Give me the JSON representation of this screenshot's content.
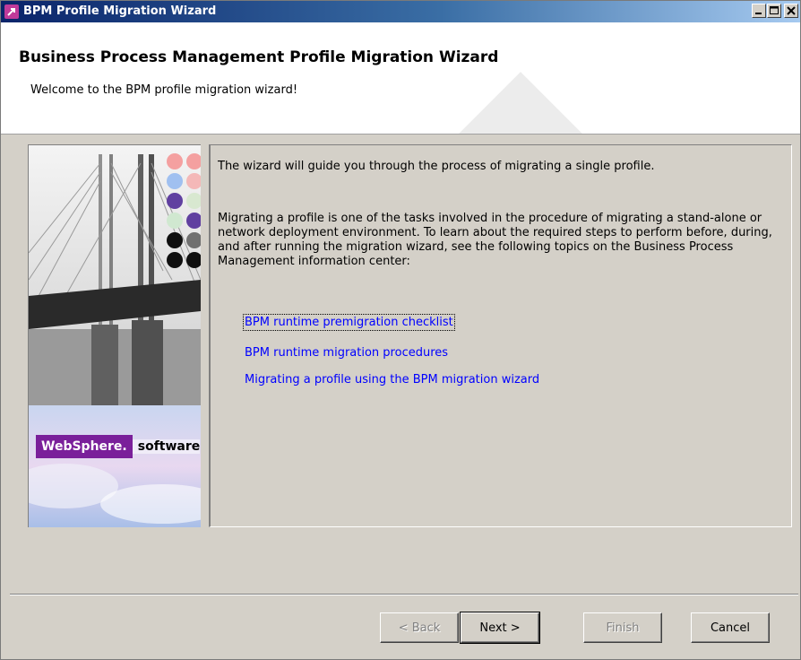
{
  "window": {
    "title": "BPM Profile Migration Wizard"
  },
  "header": {
    "title": "Business Process Management Profile Migration Wizard",
    "subtitle": "Welcome to the BPM profile migration wizard!"
  },
  "branding": {
    "logo_box": "WebSphere.",
    "logo_text": "software"
  },
  "content": {
    "intro": "The wizard will guide you through the process of migrating a single profile.",
    "details": "Migrating a profile is one of the tasks involved in the procedure of migrating a stand-alone or network deployment environment. To learn about the required steps to perform before, during, and after running the migration wizard, see the following topics on the Business Process Management information center:",
    "links": [
      "BPM runtime premigration checklist",
      "BPM runtime migration procedures",
      "Migrating a profile using the BPM migration wizard"
    ]
  },
  "buttons": {
    "back": "< Back",
    "next": "Next >",
    "finish": "Finish",
    "cancel": "Cancel"
  },
  "colors": {
    "title_bar": "#0a246a",
    "link": "#0000ff",
    "logo": "#7a1f9a"
  }
}
